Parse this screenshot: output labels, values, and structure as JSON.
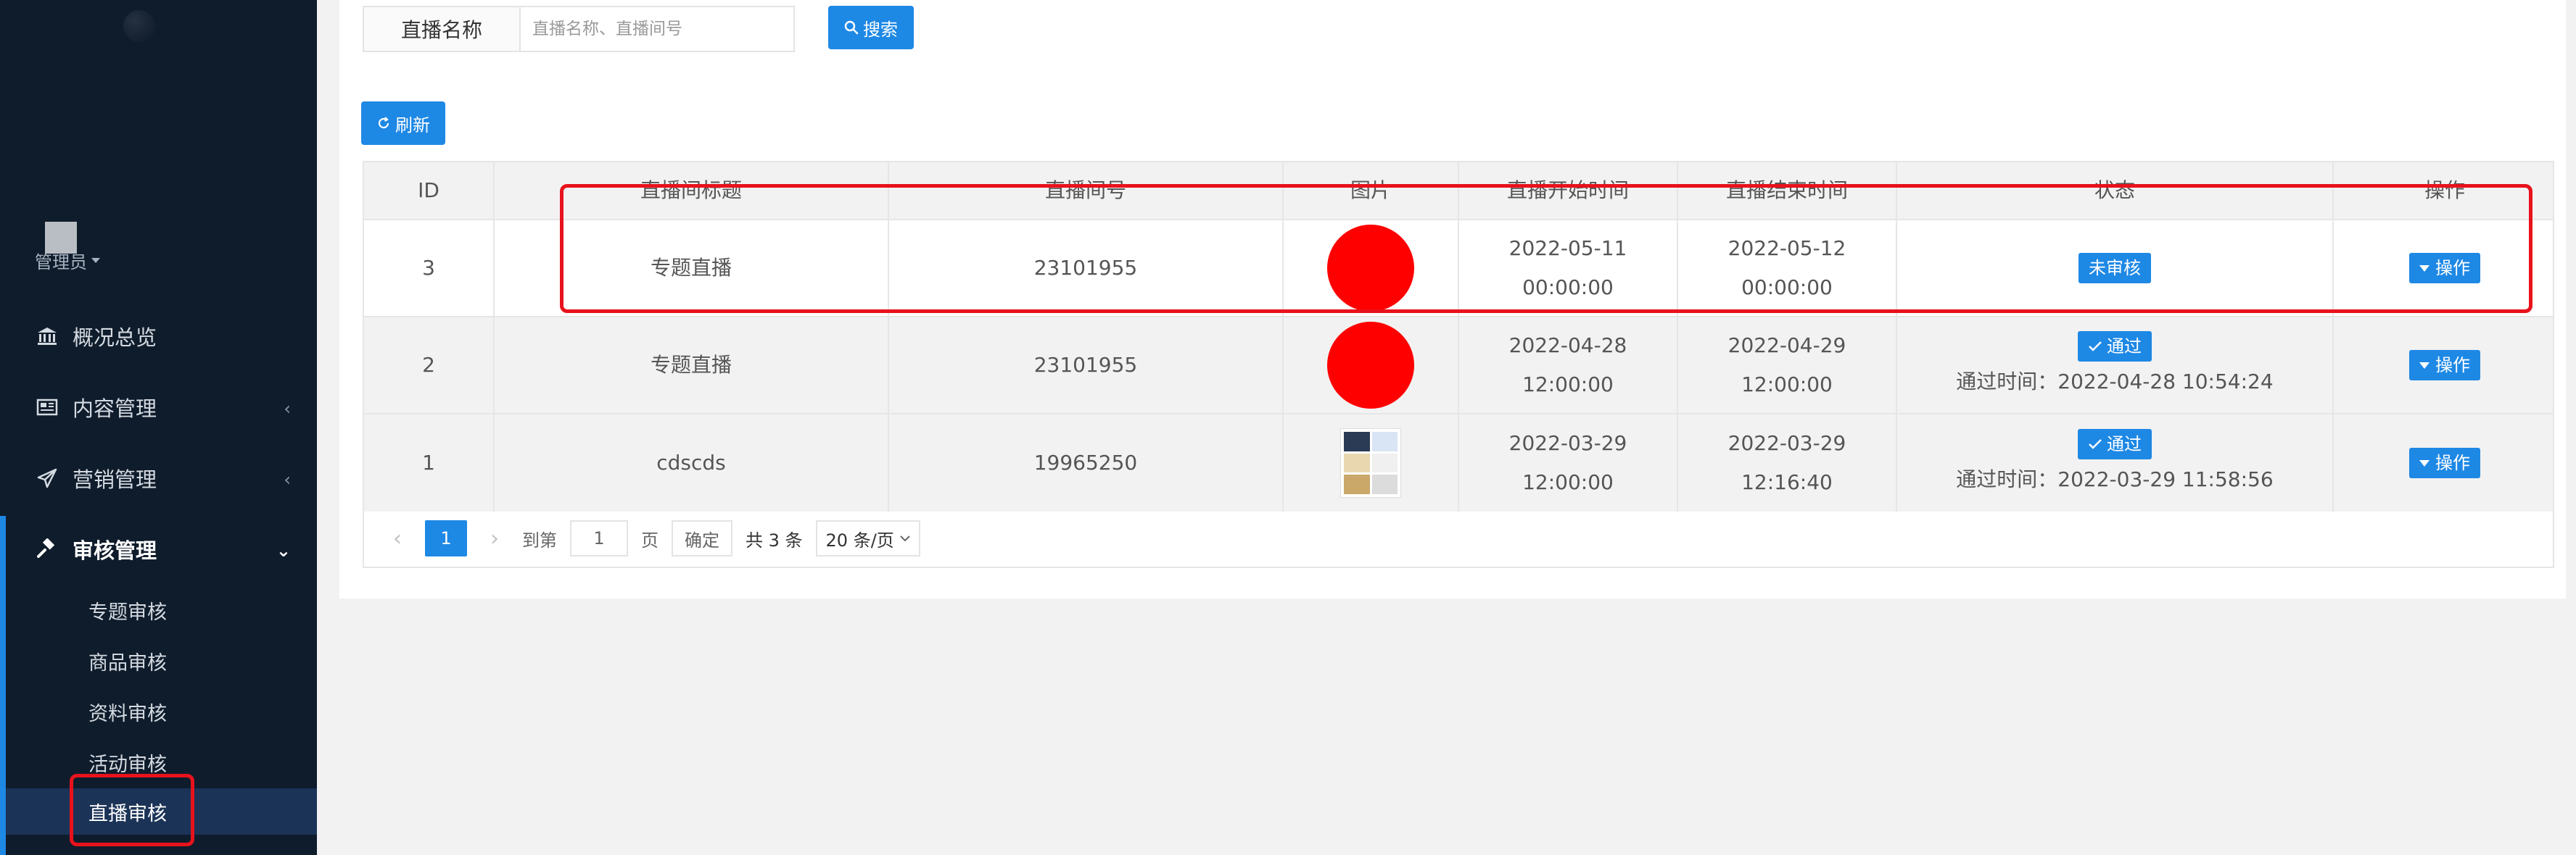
{
  "sidebar": {
    "user": {
      "name": "管理员"
    },
    "nav": [
      {
        "label": "概况总览",
        "icon": "bank-icon"
      },
      {
        "label": "内容管理",
        "icon": "newspaper-icon"
      },
      {
        "label": "营销管理",
        "icon": "send-icon"
      },
      {
        "label": "审核管理",
        "icon": "gavel-icon"
      }
    ],
    "sub_items": [
      "专题审核",
      "商品审核",
      "资料审核",
      "活动审核",
      "直播审核"
    ]
  },
  "search": {
    "label": "直播名称",
    "placeholder": "直播名称、直播间号",
    "button": "搜索"
  },
  "toolbar": {
    "refresh": "刷新"
  },
  "table": {
    "headers": [
      "ID",
      "直播间标题",
      "直播间号",
      "图片",
      "直播开始时间",
      "直播结束时间",
      "状态",
      "操作"
    ],
    "rows": [
      {
        "id": "3",
        "title": "专题直播",
        "room": "23101955",
        "start_date": "2022-05-11",
        "start_time": "00:00:00",
        "end_date": "2022-05-12",
        "end_time": "00:00:00",
        "status": "未审核",
        "pass_time": "",
        "op": "操作"
      },
      {
        "id": "2",
        "title": "专题直播",
        "room": "23101955",
        "start_date": "2022-04-28",
        "start_time": "12:00:00",
        "end_date": "2022-04-29",
        "end_time": "12:00:00",
        "status": "通过",
        "pass_time": "通过时间：2022-04-28 10:54:24",
        "op": "操作"
      },
      {
        "id": "1",
        "title": "cdscds",
        "room": "19965250",
        "start_date": "2022-03-29",
        "start_time": "12:00:00",
        "end_date": "2022-03-29",
        "end_time": "12:16:40",
        "status": "通过",
        "pass_time": "通过时间：2022-03-29 11:58:56",
        "op": "操作"
      }
    ]
  },
  "pagination": {
    "current": "1",
    "goto_label": "到第",
    "goto_value": "1",
    "page_unit": "页",
    "confirm": "确定",
    "total": "共 3 条",
    "page_size": "20 条/页"
  },
  "colors": {
    "primary": "#1e88e5",
    "sidebar": "#0f1c2c",
    "annotation": "#e8121c"
  }
}
